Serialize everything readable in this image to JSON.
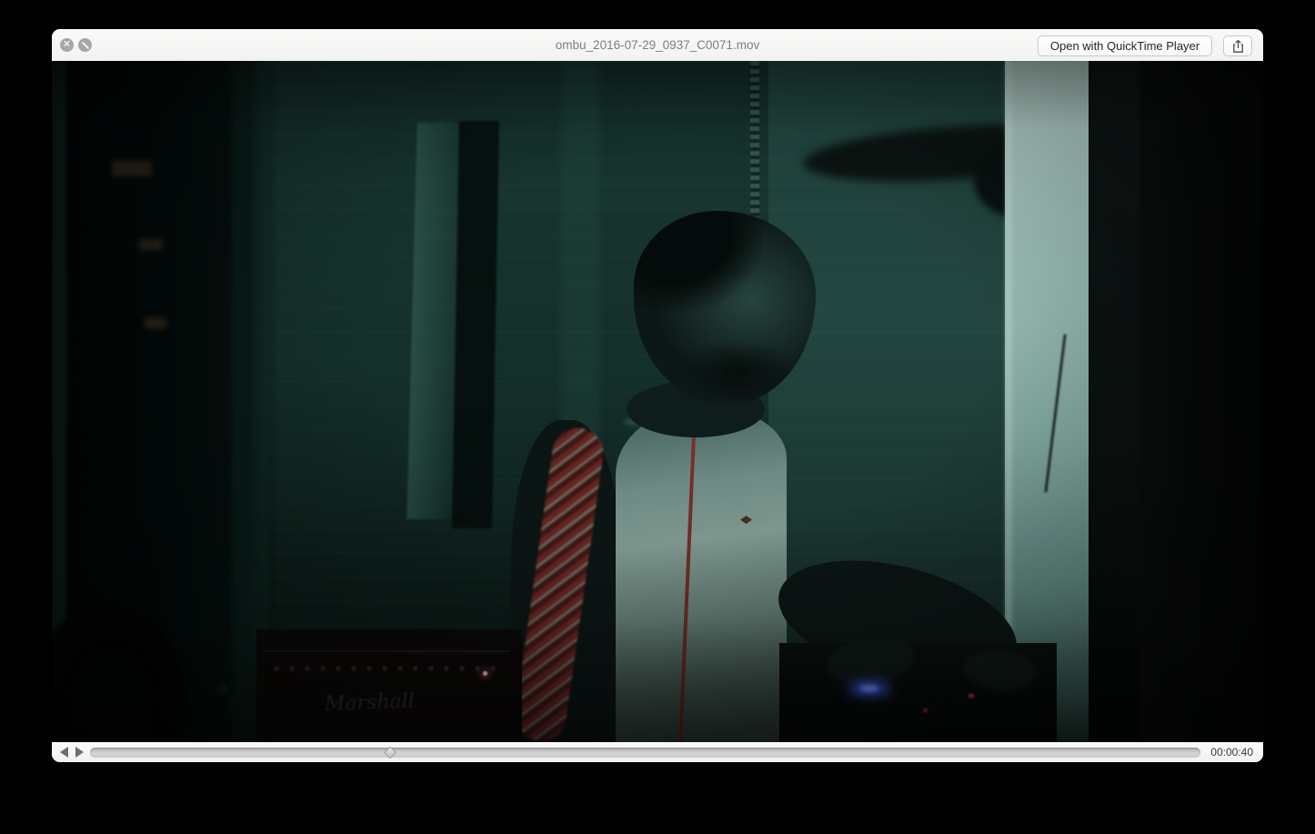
{
  "window": {
    "title": "ombu_2016-07-29_0937_C0071.mov",
    "buttons": {
      "open_with": "Open with QuickTime Player"
    },
    "icons": {
      "close": "circle-x",
      "disallow": "circle-slash",
      "share": "square-arrow-up"
    }
  },
  "player": {
    "elapsed_time": "00:00:40",
    "progress_percent": 27,
    "icons": {
      "volume": "left-triangle",
      "play": "right-triangle",
      "playhead": "diamond"
    }
  },
  "video": {
    "amp_logo": "Marshall",
    "colors": {
      "teal_wall": "#17342e",
      "projection_column": "#a9c6c0",
      "led_red": "#ffaebf",
      "gear_glow_blue": "#3a5adf"
    }
  },
  "colors": {
    "window_chrome": "#f6f6f5",
    "title_text": "#7e7e7e",
    "button_text": "#262626",
    "time_text": "#3a3a3a"
  }
}
